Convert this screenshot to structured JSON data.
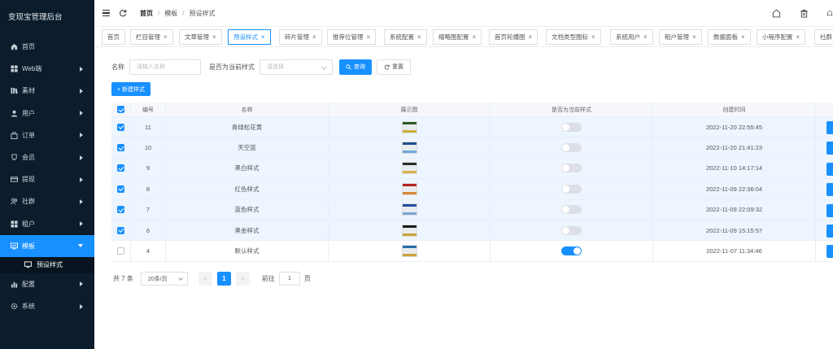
{
  "sidebar": {
    "title": "变现宝管理后台",
    "items": [
      {
        "label": "首页",
        "icon": "home-icon",
        "arrow": false
      },
      {
        "label": "Web端",
        "icon": "grid-icon",
        "arrow": true
      },
      {
        "label": "素材",
        "icon": "library-icon",
        "arrow": true
      },
      {
        "label": "用户",
        "icon": "user-icon",
        "arrow": true
      },
      {
        "label": "订单",
        "icon": "bag-icon",
        "arrow": true
      },
      {
        "label": "会员",
        "icon": "cup-icon",
        "arrow": true
      },
      {
        "label": "提现",
        "icon": "card-icon",
        "arrow": true
      },
      {
        "label": "社群",
        "icon": "group-icon",
        "arrow": true
      },
      {
        "label": "租户",
        "icon": "grid-icon",
        "arrow": true
      },
      {
        "label": "模板",
        "icon": "template-icon",
        "arrow": true,
        "active": true
      },
      {
        "label": "预设样式",
        "icon": "monitor-icon",
        "sub": true
      },
      {
        "label": "配置",
        "icon": "bar-chart-icon",
        "arrow": true
      },
      {
        "label": "系统",
        "icon": "gear-icon",
        "arrow": true
      }
    ]
  },
  "header": {
    "breadcrumb": [
      "首页",
      "模板",
      "预设样式"
    ],
    "right_icons": [
      "home-icon",
      "trash-icon",
      "bell-icon"
    ]
  },
  "tabs": [
    {
      "label": "首页",
      "closable": false
    },
    {
      "label": "栏目管理",
      "closable": true
    },
    {
      "label": "文章管理",
      "closable": true
    },
    {
      "label": "预设样式",
      "closable": true,
      "active": true
    },
    {
      "label": "碎片管理",
      "closable": true
    },
    {
      "label": "推荐位管理",
      "closable": true
    },
    {
      "label": "系统配置",
      "closable": true
    },
    {
      "label": "缩略图配置",
      "closable": true
    },
    {
      "label": "首页轮播图",
      "closable": true
    },
    {
      "label": "文档类型图标",
      "closable": true
    },
    {
      "label": "系统用户",
      "closable": true
    },
    {
      "label": "租户管理",
      "closable": true
    },
    {
      "label": "数据面板",
      "closable": true
    },
    {
      "label": "小程序配置",
      "closable": true
    },
    {
      "label": "社群",
      "closable": false
    }
  ],
  "filter": {
    "name_label": "名称",
    "name_placeholder": "请输入名称",
    "current_label": "是否为当前样式",
    "current_placeholder": "请选择",
    "search_label": "查询",
    "reset_label": "重置"
  },
  "new_button_label": "+ 新建样式",
  "table": {
    "headers": [
      "编号",
      "名称",
      "展示图",
      "是否为当前样式",
      "创建时间"
    ],
    "rows": [
      {
        "id": "11",
        "name": "青绿松花黄",
        "time": "2022-11-20 22:55:45",
        "current": false,
        "selected": true,
        "thumb": [
          "#2d5a27",
          "#c9b037"
        ]
      },
      {
        "id": "10",
        "name": "天空蓝",
        "time": "2022-11-20 21:41:23",
        "current": false,
        "selected": true,
        "thumb": [
          "#1f4f8a",
          "#6fa8dc"
        ]
      },
      {
        "id": "9",
        "name": "黑白样式",
        "time": "2022-11-10 14:17:14",
        "current": false,
        "selected": true,
        "thumb": [
          "#2b2b2b",
          "#d9b24c"
        ]
      },
      {
        "id": "8",
        "name": "红色样式",
        "time": "2022-11-09 22:36:04",
        "current": false,
        "selected": true,
        "thumb": [
          "#b3261e",
          "#d98a3a"
        ]
      },
      {
        "id": "7",
        "name": "蓝色样式",
        "time": "2022-11-09 22:09:32",
        "current": false,
        "selected": true,
        "thumb": [
          "#1e4fa0",
          "#7aa6d8"
        ]
      },
      {
        "id": "6",
        "name": "黑金样式",
        "time": "2022-11-09 15:15:57",
        "current": false,
        "selected": true,
        "thumb": [
          "#1a1a1a",
          "#c8a23c"
        ]
      },
      {
        "id": "4",
        "name": "默认样式",
        "time": "2022-11-07 11:34:46",
        "current": true,
        "selected": false,
        "thumb": [
          "#2a6ea8",
          "#cfa33a"
        ]
      }
    ]
  },
  "pagination": {
    "total": "共 7 条",
    "page_size": "20条/页",
    "prev": "<",
    "current_page": "1",
    "next": ">",
    "goto_label": "前往",
    "goto_value": "1",
    "page_suffix": "页"
  },
  "colors": {
    "accent": "#1890ff",
    "sidebar_bg": "#0b1c2c"
  }
}
